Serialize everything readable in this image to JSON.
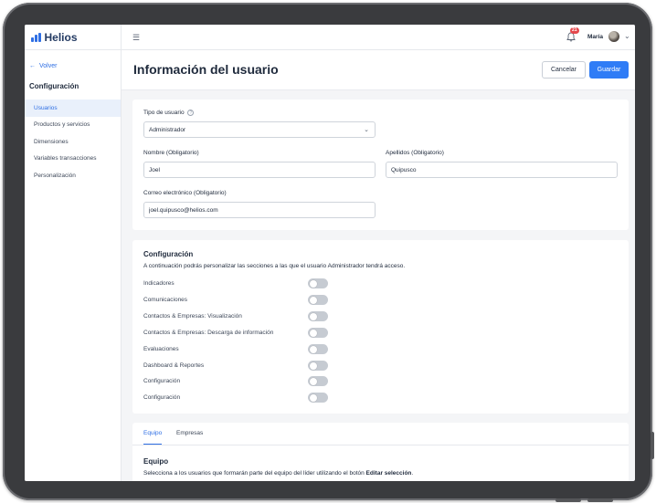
{
  "app": {
    "brand": "Helios"
  },
  "sidebar": {
    "back_label": "Volver",
    "section_title": "Configuración",
    "items": [
      {
        "label": "Usuarios",
        "active": true
      },
      {
        "label": "Productos y servicios",
        "active": false
      },
      {
        "label": "Dimensiones",
        "active": false
      },
      {
        "label": "Variables transacciones",
        "active": false
      },
      {
        "label": "Personalización",
        "active": false
      }
    ]
  },
  "topbar": {
    "notification_count": "21",
    "user_name": "María"
  },
  "header": {
    "title": "Información del usuario",
    "cancel_label": "Cancelar",
    "save_label": "Guardar"
  },
  "user_form": {
    "user_type": {
      "label": "Tipo de usuario",
      "value": "Administrador"
    },
    "first_name": {
      "label": "Nombre (Obligatorio)",
      "value": "Joel"
    },
    "last_name": {
      "label": "Apellidos (Obligatorio)",
      "value": "Quipusco"
    },
    "email": {
      "label": "Correo electrónico (Obligatorio)",
      "value": "joel.quipusco@helios.com"
    }
  },
  "config": {
    "title": "Configuración",
    "description": "A continuación podrás personalizar las secciones a las que el usuario Administrador tendrá acceso.",
    "permissions": [
      {
        "label": "Indicadores",
        "enabled": false
      },
      {
        "label": "Comunicaciones",
        "enabled": false
      },
      {
        "label": "Contactos & Empresas: Visualización",
        "enabled": false
      },
      {
        "label": "Contactos & Empresas: Descarga de información",
        "enabled": false
      },
      {
        "label": "Evaluaciones",
        "enabled": false
      },
      {
        "label": "Dashboard & Reportes",
        "enabled": false
      },
      {
        "label": "Configuración",
        "enabled": false
      },
      {
        "label": "Configuración",
        "enabled": false
      }
    ]
  },
  "team": {
    "tabs": [
      {
        "label": "Equipo",
        "active": true
      },
      {
        "label": "Empresas",
        "active": false
      }
    ],
    "title": "Equipo",
    "description_prefix": "Selecciona a los usuarios que formarán parte del equipo del líder utilizando el botón ",
    "description_bold": "Editar selección",
    "description_suffix": "."
  },
  "colors": {
    "accent": "#2f7cf6",
    "badge": "#e5484d",
    "toggle_off": "#c6cbd2"
  }
}
